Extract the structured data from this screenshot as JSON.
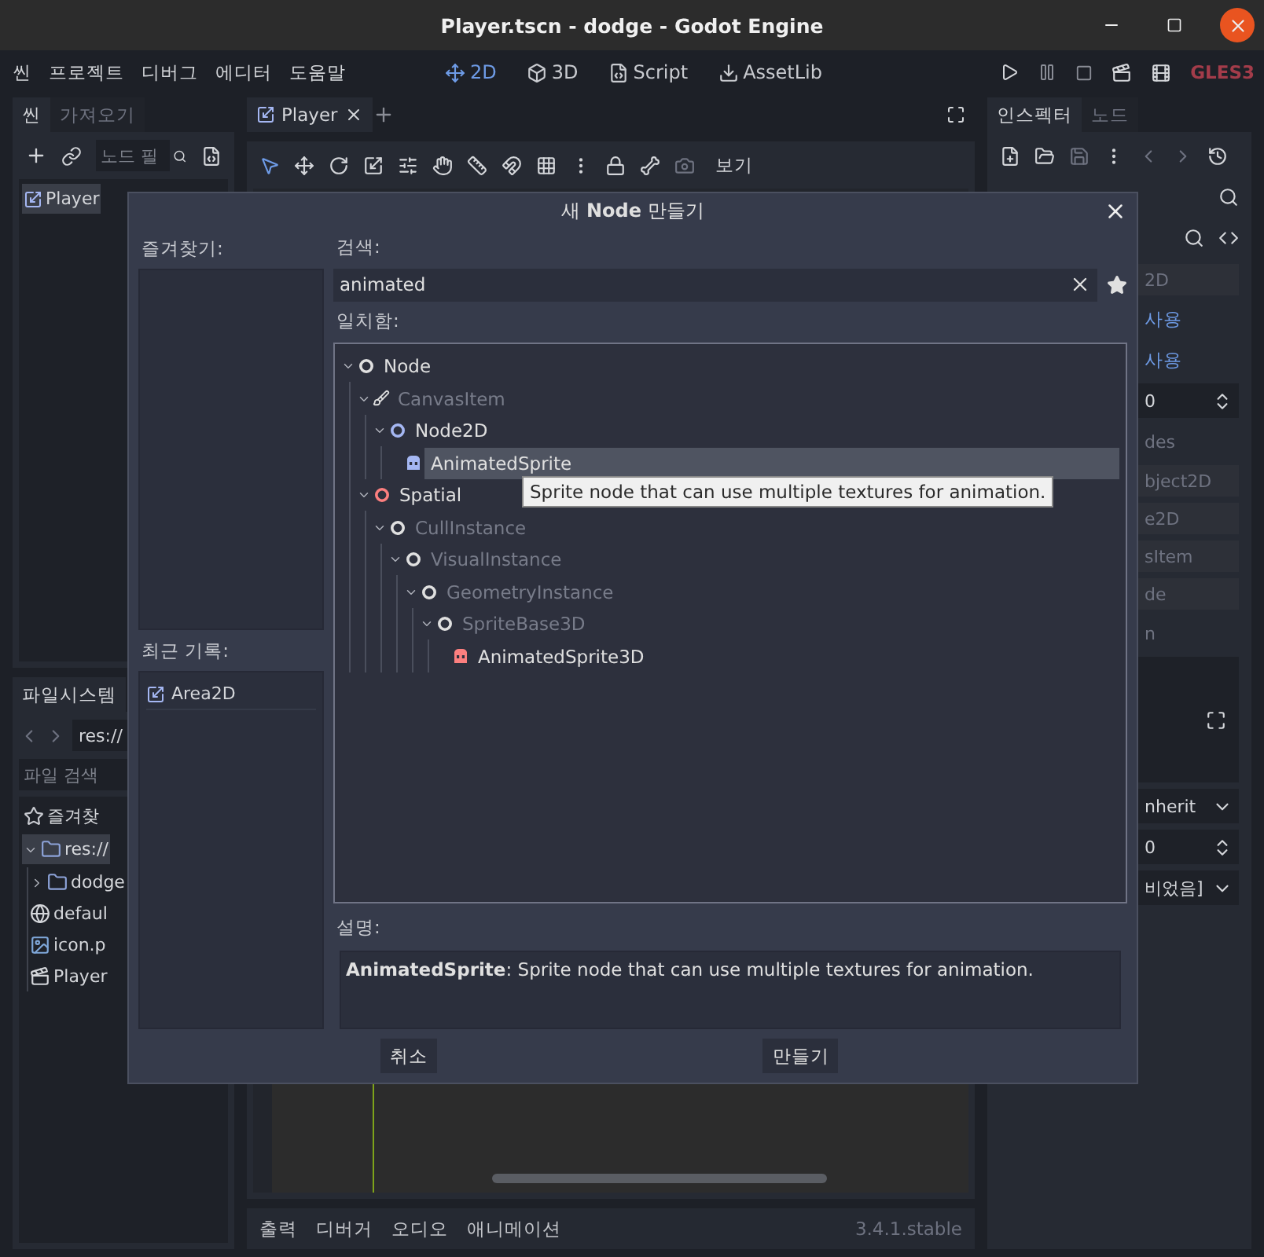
{
  "window": {
    "title": "Player.tscn - dodge - Godot Engine"
  },
  "menu": [
    "씬",
    "프로젝트",
    "디버그",
    "에디터",
    "도움말"
  ],
  "workspaces": [
    {
      "label": "2D",
      "kind": "axes",
      "selected": true
    },
    {
      "label": "3D",
      "kind": "cube",
      "selected": false
    },
    {
      "label": "Script",
      "kind": "script",
      "selected": false
    },
    {
      "label": "AssetLib",
      "kind": "assetlib",
      "selected": false
    }
  ],
  "renderer": "GLES3",
  "scene_dock": {
    "tabs": [
      {
        "label": "씬",
        "selected": true
      },
      {
        "label": "가져오기",
        "selected": false
      }
    ],
    "filter_placeholder": "노드 필",
    "tree": [
      {
        "label": "Player",
        "selected": true
      }
    ]
  },
  "filesystem_dock": {
    "tabs": [
      {
        "label": "파일시스템",
        "selected": true
      }
    ],
    "path": "res://",
    "search_placeholder": "파일 검색",
    "items": [
      {
        "kind": "favorites",
        "label": "즐겨찾",
        "selected": false
      },
      {
        "kind": "folder",
        "label": "res://",
        "selected": true,
        "expanded": true,
        "children": [
          {
            "kind": "folder",
            "label": "dodge",
            "selected": false,
            "expanded": false
          },
          {
            "kind": "globe",
            "label": "defaul",
            "selected": false
          },
          {
            "kind": "image",
            "label": "icon.p",
            "selected": false
          },
          {
            "kind": "scene",
            "label": "Player",
            "selected": false
          }
        ]
      }
    ]
  },
  "editor": {
    "tabs": [
      {
        "label": "Player",
        "selected": true
      }
    ],
    "view_menu": "보기",
    "bottom_tabs": [
      "출력",
      "디버거",
      "오디오",
      "애니메이션"
    ],
    "version": "3.4.1.stable"
  },
  "inspector": {
    "tabs": [
      {
        "label": "인스펙터",
        "selected": true
      },
      {
        "label": "노드",
        "selected": false
      }
    ],
    "rows": [
      {
        "kind": "header",
        "text": "2D"
      },
      {
        "kind": "toggle",
        "text": "사용",
        "checked": true
      },
      {
        "kind": "toggle",
        "text": "사용",
        "checked": true
      },
      {
        "kind": "spin",
        "text": "0"
      },
      {
        "kind": "text",
        "text": "des"
      },
      {
        "kind": "header",
        "text": "bject2D"
      },
      {
        "kind": "header",
        "text": "e2D"
      },
      {
        "kind": "header",
        "text": "sItem"
      },
      {
        "kind": "header",
        "text": "de"
      },
      {
        "kind": "text",
        "text": "n"
      },
      {
        "kind": "preview"
      },
      {
        "kind": "dropdown",
        "text": "nherit"
      },
      {
        "kind": "spin",
        "text": "0"
      },
      {
        "kind": "dropdown",
        "text": "비었음]"
      }
    ]
  },
  "dialog": {
    "title": "새 **Node** 만들기",
    "favorites_label": "즐겨찾기:",
    "recent_label": "최근 기록:",
    "recent": [
      {
        "label": "Area2D",
        "selected": false
      }
    ],
    "search_label": "검색:",
    "search_value": "animated",
    "matches_label": "일치함:",
    "tree": [
      {
        "label": "Node",
        "kind": "ring",
        "color": "#e0e0e0",
        "disabled": false,
        "selected": false,
        "expanded": true,
        "children": [
          {
            "label": "CanvasItem",
            "kind": "brush",
            "color": "#e0e0e0",
            "disabled": true,
            "selected": false,
            "expanded": true,
            "children": [
              {
                "label": "Node2D",
                "kind": "ring",
                "color": "#a5b7f3",
                "disabled": false,
                "selected": false,
                "expanded": true,
                "children": [
                  {
                    "label": "AnimatedSprite",
                    "kind": "sprite",
                    "color": "#a5b7f3",
                    "disabled": false,
                    "selected": true
                  }
                ]
              }
            ]
          },
          {
            "label": "Spatial",
            "kind": "ring",
            "color": "#fc7f7f",
            "disabled": false,
            "selected": false,
            "expanded": true,
            "children": [
              {
                "label": "CullInstance",
                "kind": "ring",
                "color": "#e0e0e0",
                "disabled": true,
                "selected": false,
                "expanded": true,
                "children": [
                  {
                    "label": "VisualInstance",
                    "kind": "ring",
                    "color": "#e0e0e0",
                    "disabled": true,
                    "selected": false,
                    "expanded": true,
                    "children": [
                      {
                        "label": "GeometryInstance",
                        "kind": "ring",
                        "color": "#e0e0e0",
                        "disabled": true,
                        "selected": false,
                        "expanded": true,
                        "children": [
                          {
                            "label": "SpriteBase3D",
                            "kind": "ring",
                            "color": "#e0e0e0",
                            "disabled": true,
                            "selected": false,
                            "expanded": true,
                            "children": [
                              {
                                "label": "AnimatedSprite3D",
                                "kind": "sprite",
                                "color": "#fc7f7f",
                                "disabled": false,
                                "selected": false
                              }
                            ]
                          }
                        ]
                      }
                    ]
                  }
                ]
              }
            ]
          }
        ]
      }
    ],
    "tooltip": "Sprite node that can use multiple textures for animation.",
    "description_label": "설명:",
    "description": "**AnimatedSprite**: Sprite node that can use multiple textures for animation.",
    "buttons": [
      "취소",
      "만들기"
    ]
  }
}
